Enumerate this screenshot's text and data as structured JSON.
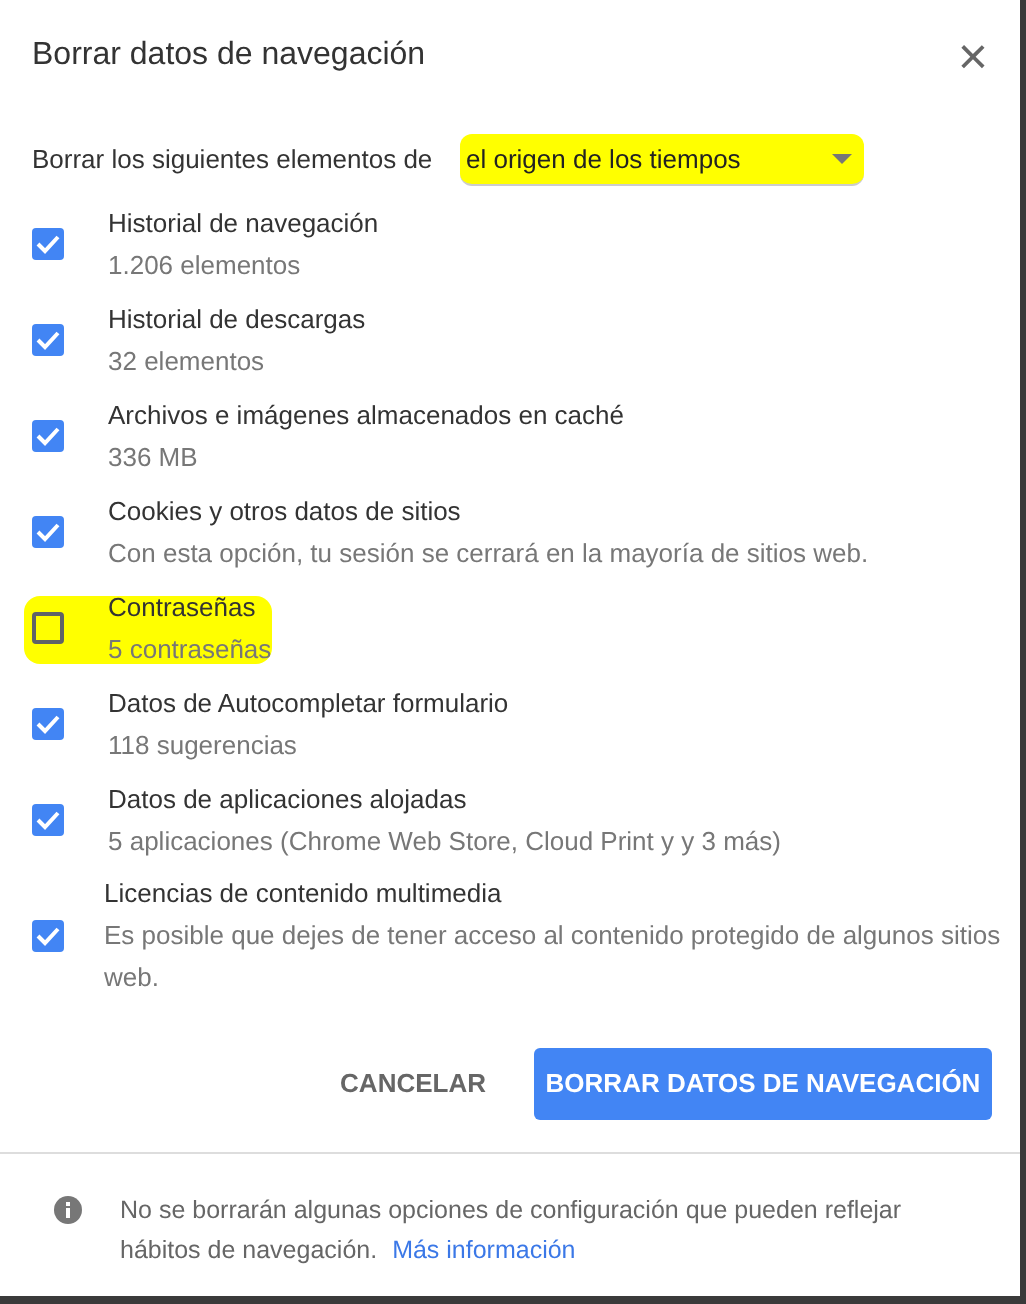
{
  "dialog": {
    "title": "Borrar datos de navegación",
    "close": "×"
  },
  "range": {
    "label": "Borrar los siguientes elementos de",
    "value": "el origen de los tiempos",
    "highlighted": true
  },
  "items": [
    {
      "label": "Historial de navegación",
      "detail": "1.206 elementos",
      "checked": true,
      "highlighted": false
    },
    {
      "label": "Historial de descargas",
      "detail": "32 elementos",
      "checked": true,
      "highlighted": false
    },
    {
      "label": "Archivos e imágenes almacenados en caché",
      "detail": "336 MB",
      "checked": true,
      "highlighted": false
    },
    {
      "label": "Cookies y otros datos de sitios",
      "detail": "Con esta opción, tu sesión se cerrará en la mayoría de sitios web.",
      "checked": true,
      "highlighted": false
    },
    {
      "label": "Contraseñas",
      "detail": "5 contraseñas",
      "checked": false,
      "highlighted": true
    },
    {
      "label": "Datos de Autocompletar formulario",
      "detail": "118 sugerencias",
      "checked": true,
      "highlighted": false
    },
    {
      "label": "Datos de aplicaciones alojadas",
      "detail": "5 aplicaciones (Chrome Web Store, Cloud Print y y 3 más)",
      "checked": true,
      "highlighted": false
    },
    {
      "label": "Licencias de contenido multimedia",
      "detail": "Es posible que dejes de tener acceso al contenido protegido de algunos sitios web.",
      "checked": true,
      "highlighted": false
    }
  ],
  "buttons": {
    "cancel": "CANCELAR",
    "confirm": "BORRAR DATOS DE NAVEGACIÓN"
  },
  "footer": {
    "text": "No se borrarán algunas opciones de configuración que pueden reflejar hábitos de navegación.",
    "link": "Más información"
  }
}
